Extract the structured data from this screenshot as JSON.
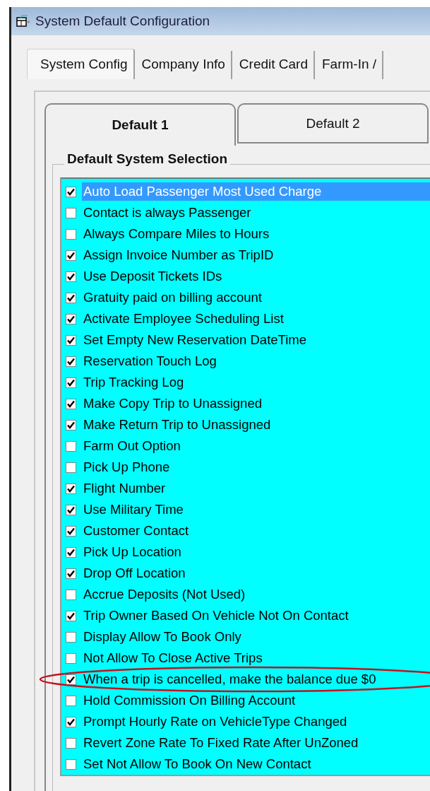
{
  "window": {
    "title": "System Default Configuration"
  },
  "tabs": [
    {
      "label": "System Config",
      "selected": true
    },
    {
      "label": "Company Info",
      "selected": false
    },
    {
      "label": "Credit Card",
      "selected": false
    },
    {
      "label": "Farm-In /",
      "selected": false
    }
  ],
  "subtabs": [
    {
      "label": "Default 1",
      "selected": true
    },
    {
      "label": "Default 2",
      "selected": false
    }
  ],
  "group": {
    "title": "Default System Selection"
  },
  "items": [
    {
      "label": "Auto Load Passenger Most Used Charge",
      "checked": true,
      "selected": true,
      "circled": false
    },
    {
      "label": "Contact is always Passenger",
      "checked": false,
      "selected": false,
      "circled": false
    },
    {
      "label": "Always Compare Miles to Hours",
      "checked": false,
      "selected": false,
      "circled": false
    },
    {
      "label": "Assign Invoice Number as TripID",
      "checked": true,
      "selected": false,
      "circled": false
    },
    {
      "label": "Use Deposit Tickets IDs",
      "checked": true,
      "selected": false,
      "circled": false
    },
    {
      "label": "Gratuity paid on billing account",
      "checked": true,
      "selected": false,
      "circled": false
    },
    {
      "label": "Activate Employee Scheduling List",
      "checked": true,
      "selected": false,
      "circled": false
    },
    {
      "label": "Set Empty New Reservation DateTime",
      "checked": true,
      "selected": false,
      "circled": false
    },
    {
      "label": "Reservation Touch Log",
      "checked": true,
      "selected": false,
      "circled": false
    },
    {
      "label": "Trip Tracking Log",
      "checked": true,
      "selected": false,
      "circled": false
    },
    {
      "label": "Make Copy Trip to Unassigned",
      "checked": true,
      "selected": false,
      "circled": false
    },
    {
      "label": "Make Return Trip to Unassigned",
      "checked": true,
      "selected": false,
      "circled": false
    },
    {
      "label": "Farm Out Option",
      "checked": false,
      "selected": false,
      "circled": false
    },
    {
      "label": "Pick Up Phone",
      "checked": false,
      "selected": false,
      "circled": false
    },
    {
      "label": "Flight Number",
      "checked": true,
      "selected": false,
      "circled": false
    },
    {
      "label": "Use Military Time",
      "checked": true,
      "selected": false,
      "circled": false
    },
    {
      "label": "Customer Contact",
      "checked": true,
      "selected": false,
      "circled": false
    },
    {
      "label": "Pick Up Location",
      "checked": true,
      "selected": false,
      "circled": false
    },
    {
      "label": "Drop Off Location",
      "checked": true,
      "selected": false,
      "circled": false
    },
    {
      "label": "Accrue Deposits (Not Used)",
      "checked": false,
      "selected": false,
      "circled": false
    },
    {
      "label": "Trip Owner Based On Vehicle Not On Contact",
      "checked": true,
      "selected": false,
      "circled": false
    },
    {
      "label": "Display Allow To Book Only",
      "checked": false,
      "selected": false,
      "circled": false
    },
    {
      "label": "Not Allow To Close Active Trips",
      "checked": false,
      "selected": false,
      "circled": false
    },
    {
      "label": "When a trip is cancelled, make the balance due $0",
      "checked": true,
      "selected": false,
      "circled": true
    },
    {
      "label": "Hold Commission On Billing Account",
      "checked": false,
      "selected": false,
      "circled": false
    },
    {
      "label": "Prompt Hourly Rate on VehicleType Changed",
      "checked": true,
      "selected": false,
      "circled": false
    },
    {
      "label": "Revert Zone Rate To Fixed Rate After UnZoned",
      "checked": false,
      "selected": false,
      "circled": false
    },
    {
      "label": "Set Not Allow To Book On New Contact",
      "checked": false,
      "selected": false,
      "circled": false
    }
  ]
}
